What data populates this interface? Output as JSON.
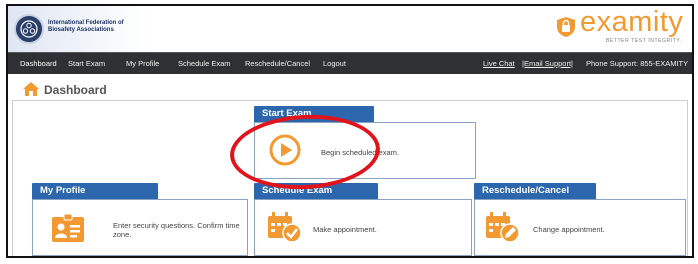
{
  "header": {
    "org_name": "International Federation of Biosafety Associations",
    "brand_name": "examity",
    "brand_tagline": "BETTER TEST INTEGRITY.",
    "brand_color": "#f29a31"
  },
  "navbar": {
    "items": [
      {
        "label": "Dashboard",
        "active": true
      },
      {
        "label": "Start Exam"
      },
      {
        "label": "My Profile"
      },
      {
        "label": "Schedule Exam"
      },
      {
        "label": "Reschedule/Cancel"
      },
      {
        "label": "Logout"
      }
    ],
    "right": {
      "live_chat": "Live Chat",
      "email_support": "|Email Support|",
      "phone_support": "Phone Support: 855-EXAMITY"
    }
  },
  "page": {
    "title": "Dashboard",
    "icon": "home-icon"
  },
  "cards": {
    "start_exam": {
      "title": "Start Exam",
      "text": "Begin scheduled exam.",
      "icon": "play-icon"
    },
    "my_profile": {
      "title": "My Profile",
      "text": "Enter security questions. Confirm time zone.",
      "icon": "profile-card-icon"
    },
    "schedule_exam": {
      "title": "Schedule Exam",
      "text": "Make appointment.",
      "icon": "calendar-check-icon"
    },
    "reschedule_cancel": {
      "title": "Reschedule/Cancel",
      "text": "Change appointment.",
      "icon": "calendar-edit-icon"
    }
  },
  "colors": {
    "accent": "#f29a31",
    "card_header": "#2c67ad",
    "navbar": "#2f3033",
    "highlight_oval": "#e1141b"
  }
}
